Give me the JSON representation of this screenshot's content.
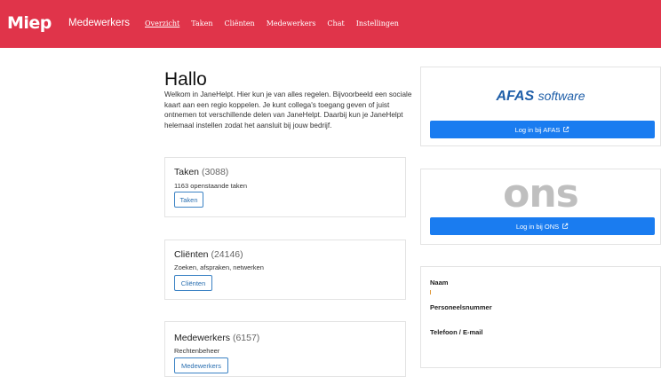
{
  "navbar": {
    "brand": "Miep",
    "brand_sub": "Medewerkers",
    "links": [
      "Overzicht",
      "Taken",
      "Cliënten",
      "Medewerkers",
      "Chat",
      "Instellingen"
    ],
    "active_index": 0
  },
  "welcome": {
    "title": "Hallo",
    "text": "Welkom in JaneHelpt. Hier kun je van alles regelen. Bijvoorbeeld een sociale kaart aan een regio koppelen. Je kunt collega's toegang geven of juist ontnemen tot verschillende delen van JaneHelpt. Daarbij kun je JaneHelpt helemaal instellen zodat het aansluit bij jouw bedrijf."
  },
  "cards": {
    "taken": {
      "title": "Taken",
      "count": "(3088)",
      "subtitle": "1163 openstaande taken",
      "button": "Taken"
    },
    "clienten": {
      "title": "Cliënten",
      "count": "(24146)",
      "subtitle": "Zoeken, afspraken, netwerken",
      "button": "Cliënten"
    },
    "medewerkers": {
      "title": "Medewerkers",
      "count": "(6157)",
      "subtitle": "Rechtenbeheer",
      "button": "Medewerkers"
    }
  },
  "afas": {
    "logo_main": "AFAS",
    "logo_sub": "software",
    "button": "Log in bij AFAS"
  },
  "ons": {
    "logo": "ons",
    "button": "Log in bij ONS"
  },
  "profile": {
    "name_label": "Naam",
    "number_label": "Personeelsnummer",
    "contact_label": "Telefoon / E-mail"
  },
  "colors": {
    "navbar": "#e0344a",
    "primary": "#1a7cf0",
    "afas_blue": "#1e5ea8"
  },
  "icons": {
    "external_link": "external-link-icon"
  }
}
